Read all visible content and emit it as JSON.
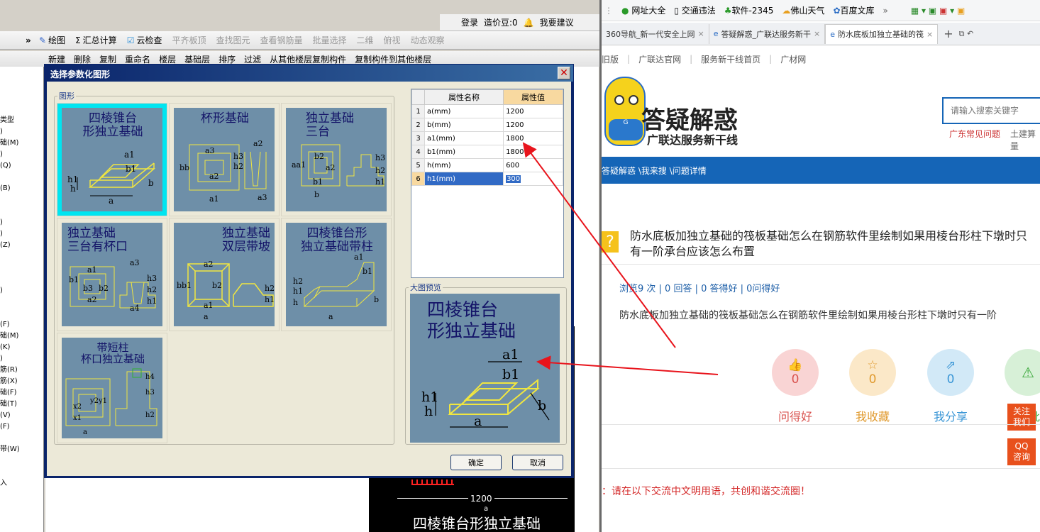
{
  "app": {
    "top_login": "登录",
    "top_beans": "造价豆:0",
    "top_suggest": "我要建议",
    "toolbar1": [
      "绘图",
      "汇总计算",
      "云检查",
      "平齐板顶",
      "查找图元",
      "查看钢筋量",
      "批量选择",
      "二维",
      "俯视",
      "动态观察"
    ],
    "toolbar2": [
      "新建",
      "删除",
      "复制",
      "重命名",
      "楼层",
      "基础层",
      "排序",
      "过滤",
      "从其他楼层复制构件",
      "复制构件到其他楼层"
    ],
    "tree_items": [
      "类型",
      ")",
      "础(M)",
      ")",
      "(Q)",
      "",
      "(B)",
      "",
      "",
      ")",
      ")",
      "(Z)",
      "",
      "",
      "",
      ")",
      "",
      "",
      "(F)",
      "础(M)",
      "(K)",
      ")",
      "筋(R)",
      "筋(X)",
      "础(F)",
      "础(T)",
      "(V)",
      "(F)",
      "",
      "带(W)",
      "",
      "",
      "入"
    ],
    "cad_dim": "1200",
    "cad_label": "四棱锥台形独立基础",
    "cad_sub": "a"
  },
  "dialog": {
    "title": "选择参数化图形",
    "shapes_legend": "图形",
    "preview_legend": "大图预览",
    "shapes": [
      {
        "label": "四棱锥台\n形独立基础",
        "selected": true
      },
      {
        "label": "杯形基础",
        "selected": false
      },
      {
        "label": "独立基础\n三台",
        "selected": false
      },
      {
        "label": "独立基础\n三台有杯口",
        "selected": false
      },
      {
        "label": "独立基础\n双层带坡",
        "selected": false
      },
      {
        "label": "四棱锥台形\n独立基础带柱",
        "selected": false
      },
      {
        "label": "带短柱\n杯口独立基础",
        "selected": false
      }
    ],
    "props_header_name": "属性名称",
    "props_header_value": "属性值",
    "props": [
      {
        "idx": "1",
        "name": "a(mm)",
        "value": "1200"
      },
      {
        "idx": "2",
        "name": "b(mm)",
        "value": "1200"
      },
      {
        "idx": "3",
        "name": "a1(mm)",
        "value": "1800"
      },
      {
        "idx": "4",
        "name": "b1(mm)",
        "value": "1800"
      },
      {
        "idx": "5",
        "name": "h(mm)",
        "value": "600"
      },
      {
        "idx": "6",
        "name": "h1(mm)",
        "value": "300"
      }
    ],
    "preview_label": "四棱锥台\n形独立基础",
    "ok": "确定",
    "cancel": "取消"
  },
  "browser": {
    "bookmarks": [
      "网址大全",
      "交通违法",
      "软件-2345",
      "佛山天气",
      "百度文库"
    ],
    "tabs": [
      {
        "title": "360导航_新一代安全上网",
        "active": false
      },
      {
        "title": "答疑解惑_广联达服务新干",
        "active": false
      },
      {
        "title": "防水底板加独立基础的筏",
        "active": true
      }
    ],
    "sitenav": [
      "旧版",
      "广联达官网",
      "服务新干线首页",
      "广材网"
    ],
    "logo_title": "答疑解惑",
    "logo_sub": "广联达服务新干线",
    "search_placeholder": "请输入搜索关键字",
    "hot_links": [
      "广东常见问题",
      "土建算量"
    ],
    "breadcrumb": "答疑解惑 \\我来搜 \\问题详情",
    "question_title": "防水底板加独立基础的筏板基础怎么在钢筋软件里绘制如果用棱台形柱下墩时只有一阶承台应该怎么布置",
    "stats": "浏览9 次 | 0 回答 | 0 答得好 | 0问得好",
    "question_body": "防水底板加独立基础的筏板基础怎么在钢筋软件里绘制如果用棱台形柱下墩时只有一阶",
    "actions": [
      {
        "count": "0",
        "label": "问得好",
        "color": "#f9d4d4",
        "text": "#d9534f"
      },
      {
        "count": "0",
        "label": "我收藏",
        "color": "#fbe8c8",
        "text": "#e09a2e"
      },
      {
        "count": "0",
        "label": "我分享",
        "color": "#d2e9f7",
        "text": "#3a96d6"
      },
      {
        "count": "",
        "label": "批",
        "color": "#d7f0d7",
        "text": "#3aa83a"
      }
    ],
    "side_follow": "关注\n我们",
    "side_qq": "QQ\n咨询",
    "notice": "：请在以下交流中文明用语，共创和谐交流圈！"
  }
}
